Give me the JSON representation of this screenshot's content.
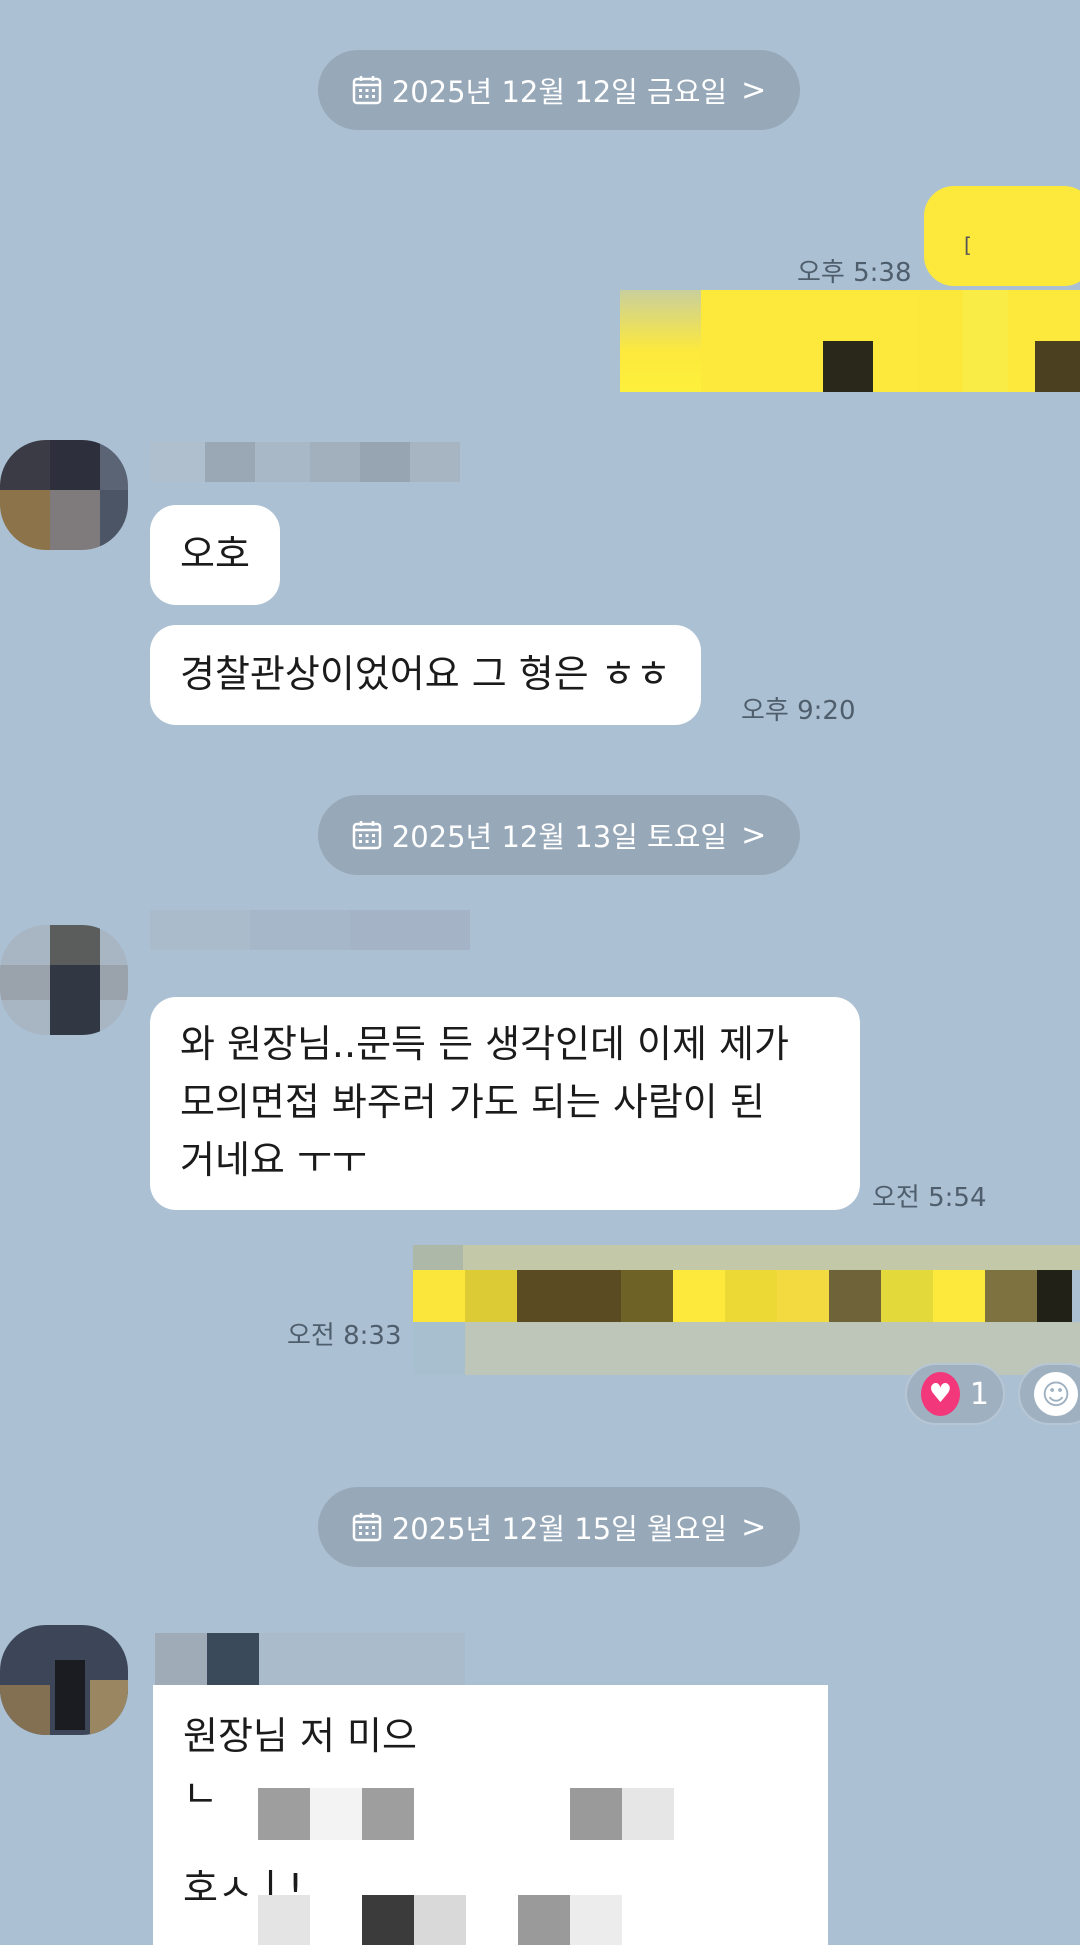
{
  "dates": [
    {
      "label": "2025년 12월 12일 금요일",
      "icon": "calendar-icon",
      "chevron": ">"
    },
    {
      "label": "2025년 12월 13일 토요일",
      "icon": "calendar-icon",
      "chevron": ">"
    },
    {
      "label": "2025년 12월 15일 월요일",
      "icon": "calendar-icon",
      "chevron": ">"
    }
  ],
  "messages": [
    {
      "side": "me",
      "text": "",
      "time": "오후 5:38"
    },
    {
      "side": "other",
      "text": "오호",
      "time": ""
    },
    {
      "side": "other",
      "text": "경찰관상이었어요 그 형은 ㅎㅎ",
      "time": "오후 9:20"
    },
    {
      "side": "other",
      "lines": [
        "와 원장님..문득 든 생각인데 이제 제가",
        "모의면접 봐주러 가도 되는 사람이 된",
        "거네요 ㅜㅜ"
      ],
      "time": "오전 5:54"
    },
    {
      "side": "me",
      "text": "",
      "time": "오전 8:33"
    },
    {
      "side": "other",
      "lines": [
        "원장님 저 미으",
        "ㄴ",
        "호ㅅㅣ!"
      ],
      "time": ""
    }
  ],
  "reactions": {
    "heart_count": "1",
    "heart_icon": "heart-icon",
    "add_icon": "smile-icon"
  },
  "colors": {
    "background": "#abc0d3",
    "my_bubble": "#fde93c",
    "other_bubble": "#ffffff",
    "date_pill": "#97a8b8",
    "heart": "#f2387b"
  }
}
